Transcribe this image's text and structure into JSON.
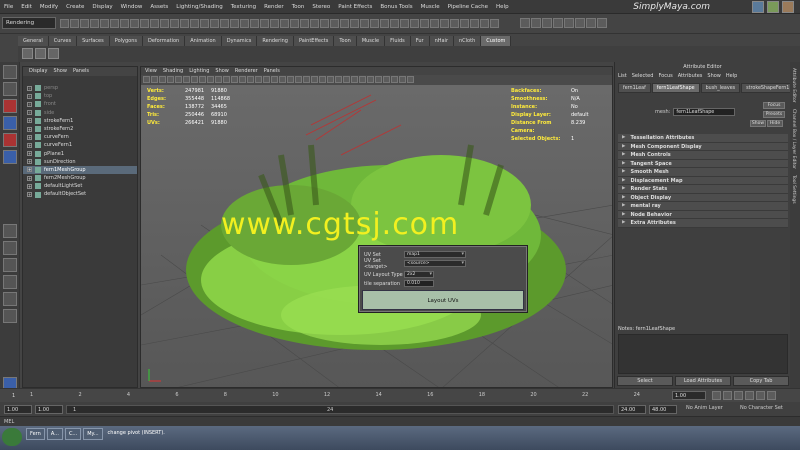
{
  "menubar": [
    "File",
    "Edit",
    "Modify",
    "Create",
    "Display",
    "Window",
    "Assets",
    "Lighting/Shading",
    "Texturing",
    "Render",
    "Toon",
    "Stereo",
    "Paint Effects",
    "Bonus Tools",
    "Muscle",
    "Pipeline Cache",
    "Help"
  ],
  "brand": "SimplyMaya.com",
  "mode": "Rendering",
  "shelf_tabs": [
    "General",
    "Curves",
    "Surfaces",
    "Polygons",
    "Deformation",
    "Animation",
    "Dynamics",
    "Rendering",
    "PaintEffects",
    "Toon",
    "Muscle",
    "Fluids",
    "Fur",
    "nHair",
    "nCloth",
    "Custom"
  ],
  "shelf_active": "Custom",
  "outliner": {
    "menu": [
      "Display",
      "Show",
      "Panels"
    ],
    "items": [
      {
        "label": "persp",
        "dim": true
      },
      {
        "label": "top",
        "dim": true
      },
      {
        "label": "front",
        "dim": true
      },
      {
        "label": "side",
        "dim": true
      },
      {
        "label": "strokeFern1",
        "dim": false
      },
      {
        "label": "strokeFern2",
        "dim": false
      },
      {
        "label": "curveFern",
        "dim": false
      },
      {
        "label": "curveFern1",
        "dim": false
      },
      {
        "label": "pPlane1",
        "dim": false
      },
      {
        "label": "sunDirection",
        "dim": false
      },
      {
        "label": "fern1MeshGroup",
        "dim": false,
        "selected": true
      },
      {
        "label": "fern2MeshGroup",
        "dim": false
      },
      {
        "label": "defaultLightSet",
        "dim": false
      },
      {
        "label": "defaultObjectSet",
        "dim": false
      }
    ]
  },
  "viewport": {
    "menu": [
      "View",
      "Shading",
      "Lighting",
      "Show",
      "Renderer",
      "Panels"
    ],
    "hud_left": [
      {
        "label": "Verts:",
        "v1": "247981",
        "v2": "91880"
      },
      {
        "label": "Edges:",
        "v1": "355448",
        "v2": "114868"
      },
      {
        "label": "Faces:",
        "v1": "138772",
        "v2": "34465"
      },
      {
        "label": "Tris:",
        "v1": "250446",
        "v2": "68910"
      },
      {
        "label": "UVs:",
        "v1": "266421",
        "v2": "91880"
      }
    ],
    "hud_right": [
      {
        "label": "Backfaces:",
        "value": "On"
      },
      {
        "label": "Smoothness:",
        "value": "N/A"
      },
      {
        "label": "Instance:",
        "value": "No"
      },
      {
        "label": "Display Layer:",
        "value": "default"
      },
      {
        "label": "Distance From Camera:",
        "value": "8.239"
      },
      {
        "label": "Selected Objects:",
        "value": "1"
      }
    ],
    "watermark": "www.cgtsj.com"
  },
  "uv_dialog": {
    "uv_set_label": "UV Set",
    "uv_set_value": "map1",
    "uv_set_target_label": "UV Set <target>",
    "uv_set_target_value": "<source>",
    "layout_type_label": "UV Layout Type",
    "layout_type_value": "2x2",
    "separation_label": "tile separation",
    "separation_value": "0.010",
    "button_label": "Layout UVs"
  },
  "attr_editor": {
    "title": "Attribute Editor",
    "menu": [
      "List",
      "Selected",
      "Focus",
      "Attributes",
      "Show",
      "Help"
    ],
    "tabs": [
      "fern1Leaf",
      "fern1LeafShape",
      "bush_leaves",
      "strokeShapeFern1"
    ],
    "active_tab": "fern1LeafShape",
    "mesh_label": "mesh:",
    "mesh_value": "fern1LeafShape",
    "focus_label": "Focus",
    "presets_label": "Presets",
    "show_label": "Show",
    "hide_label": "Hide",
    "sections": [
      "Tessellation Attributes",
      "Mesh Component Display",
      "Mesh Controls",
      "Tangent Space",
      "Smooth Mesh",
      "Displacement Map",
      "Render Stats",
      "Object Display",
      "mental ray",
      "Node Behavior",
      "Extra Attributes"
    ],
    "notes_label": "Notes: fern1LeafShape",
    "buttons": [
      "Select",
      "Load Attributes",
      "Copy Tab"
    ]
  },
  "side_tabs": [
    "Attribute Editor",
    "Channel Box / Layer Editor",
    "Tool Settings"
  ],
  "timeline": {
    "start": "1",
    "ticks": [
      "1",
      "2",
      "4",
      "6",
      "8",
      "10",
      "12",
      "14",
      "16",
      "18",
      "20",
      "22",
      "24"
    ],
    "current": "1.00"
  },
  "range": {
    "start": "1.00",
    "start2": "1.00",
    "marker": "1",
    "end_marker": "24",
    "end": "24.00",
    "end2": "48.00",
    "anim_layer": "No Anim Layer",
    "char_set": "No Character Set"
  },
  "cmdline": {
    "label": "MEL"
  },
  "taskbar": {
    "items": [
      "Fern",
      "A...",
      "C...",
      "My...",
      "change pivot (INSERT)."
    ]
  },
  "colors": {
    "accent_yellow": "#f2f020",
    "fern_green": "#7fd84a",
    "hud_yellow": "#ffeb3b"
  }
}
